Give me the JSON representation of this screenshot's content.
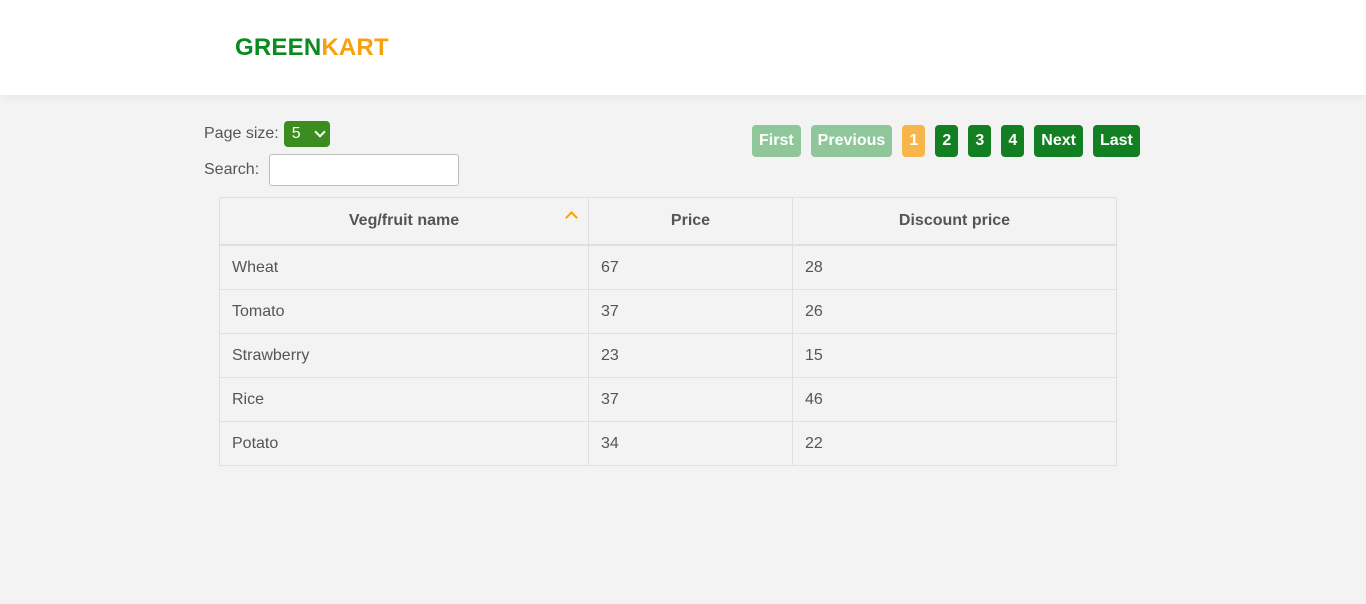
{
  "brand": {
    "part1": "GREEN",
    "part2": "KART"
  },
  "page_size": {
    "label": "Page size:",
    "value": "5"
  },
  "search": {
    "label": "Search:",
    "value": "",
    "placeholder": ""
  },
  "pagination": {
    "first": "First",
    "previous": "Previous",
    "pages": [
      "1",
      "2",
      "3",
      "4"
    ],
    "current": "1",
    "next": "Next",
    "last": "Last"
  },
  "table": {
    "headers": [
      "Veg/fruit name",
      "Price",
      "Discount price"
    ],
    "sort": "ascending",
    "rows": [
      [
        "Wheat",
        "67",
        "28"
      ],
      [
        "Tomato",
        "37",
        "26"
      ],
      [
        "Strawberry",
        "23",
        "15"
      ],
      [
        "Rice",
        "37",
        "46"
      ],
      [
        "Potato",
        "34",
        "22"
      ]
    ]
  },
  "colors": {
    "brand_green": "#0a8a1f",
    "brand_orange": "#f6a10f",
    "button_green": "#127f22",
    "active_page": "#f7b54a"
  }
}
